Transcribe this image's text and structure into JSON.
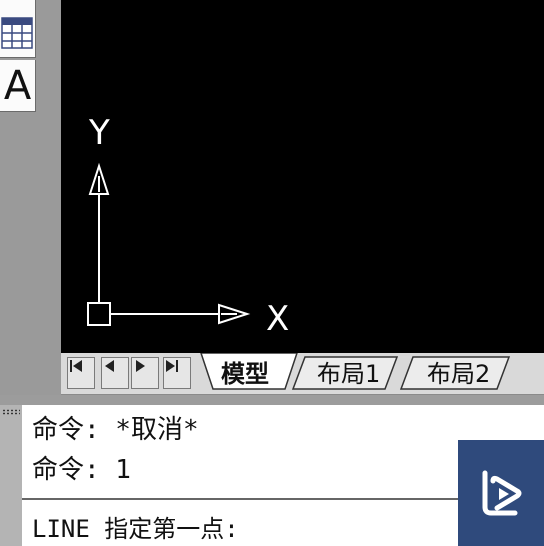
{
  "canvas": {
    "background": "#000000",
    "ucs": {
      "y_label": "Y",
      "x_label": "X",
      "color": "#ffffff"
    }
  },
  "palette": {
    "table_icon": "table-icon",
    "text_tool_glyph": "A"
  },
  "tabs": {
    "nav": {
      "first": "first-tab-icon",
      "prev": "prev-tab-icon",
      "next": "next-tab-icon",
      "last": "last-tab-icon"
    },
    "items": [
      {
        "label": "模型",
        "active": true
      },
      {
        "label": "布局1",
        "active": false
      },
      {
        "label": "布局2",
        "active": false
      }
    ]
  },
  "command": {
    "history": [
      "命令: *取消*",
      "命令: 1"
    ],
    "prompt": "LINE 指定第一点:"
  },
  "colors": {
    "logo_background": "#2f4a7c",
    "tab_bar": "#d9d9d9",
    "window": "#ffffff"
  }
}
